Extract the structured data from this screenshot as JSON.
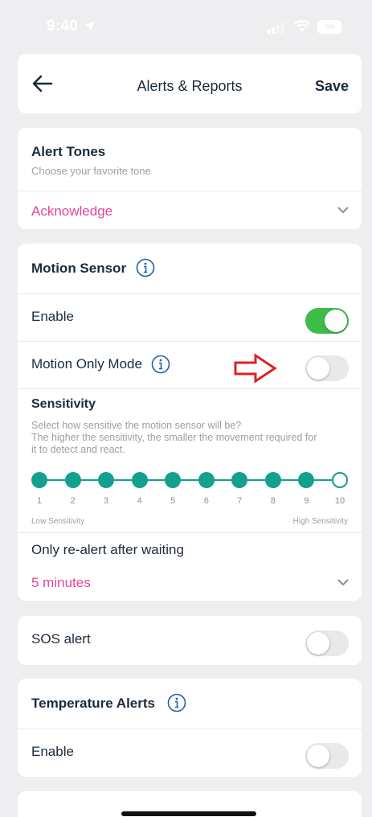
{
  "status_bar": {
    "time": "9:40",
    "battery": "44"
  },
  "header": {
    "title": "Alerts & Reports",
    "save_label": "Save"
  },
  "alert_tones": {
    "title": "Alert Tones",
    "subtitle": "Choose your favorite tone",
    "selected": "Acknowledge"
  },
  "motion_sensor": {
    "title": "Motion Sensor",
    "enable_label": "Enable",
    "enable_on": true,
    "motion_only_label": "Motion Only Mode",
    "motion_only_on": false,
    "sensitivity": {
      "title": "Sensitivity",
      "description_line1": "Select how sensitive the motion sensor will be?",
      "description_line2": "The higher the sensitivity, the smaller the movement required for",
      "description_line3": "it to detect and react.",
      "levels": [
        "1",
        "2",
        "3",
        "4",
        "5",
        "6",
        "7",
        "8",
        "9",
        "10"
      ],
      "selected": 10,
      "low_label": "Low Sensitivity",
      "high_label": "High Sensitivity"
    },
    "realert_label": "Only re-alert after waiting",
    "realert_value": "5 minutes"
  },
  "sos": {
    "label": "SOS alert",
    "on": false
  },
  "temperature_alerts": {
    "title": "Temperature Alerts",
    "enable_label": "Enable",
    "enable_on": false
  },
  "colors": {
    "accent_pink": "#e2479a",
    "teal": "#13a08f",
    "toggle_on": "#3ebc4a",
    "annotation_red": "#e02020"
  }
}
